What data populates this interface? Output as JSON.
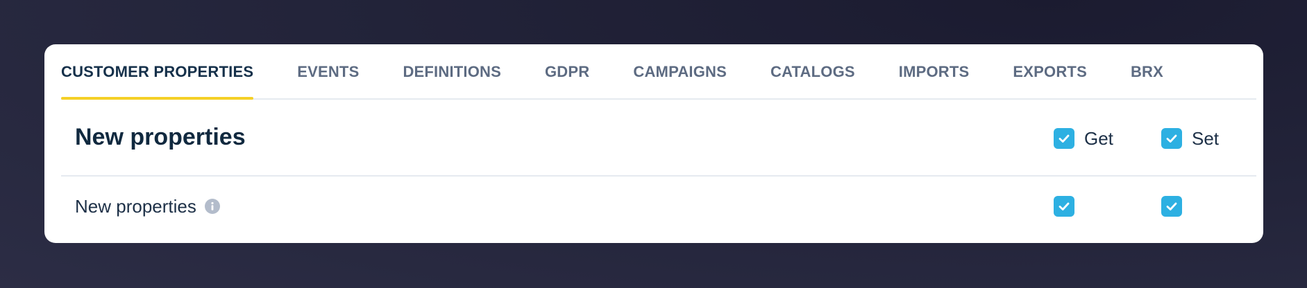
{
  "tabs": [
    {
      "label": "CUSTOMER PROPERTIES",
      "active": true
    },
    {
      "label": "EVENTS",
      "active": false
    },
    {
      "label": "DEFINITIONS",
      "active": false
    },
    {
      "label": "GDPR",
      "active": false
    },
    {
      "label": "CAMPAIGNS",
      "active": false
    },
    {
      "label": "CATALOGS",
      "active": false
    },
    {
      "label": "IMPORTS",
      "active": false
    },
    {
      "label": "EXPORTS",
      "active": false
    },
    {
      "label": "BRX",
      "active": false
    }
  ],
  "section": {
    "title": "New properties",
    "columns": {
      "get": {
        "label": "Get",
        "checked": true
      },
      "set": {
        "label": "Set",
        "checked": true
      }
    }
  },
  "rows": [
    {
      "label": "New properties",
      "info_icon": "info-icon",
      "get_checked": true,
      "set_checked": true
    }
  ],
  "colors": {
    "accent_underline": "#f5d027",
    "checkbox": "#2db0e2",
    "title": "#10293f",
    "tab_inactive": "#5d6b82"
  }
}
